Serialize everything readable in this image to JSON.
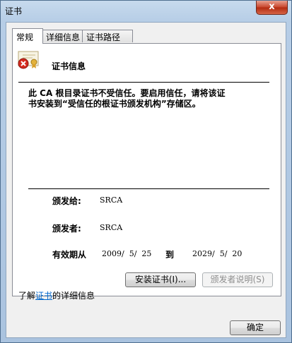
{
  "window": {
    "title": "证书",
    "close_label": "x"
  },
  "tabs": [
    {
      "label": "常规",
      "active": true
    },
    {
      "label": "详细信息",
      "active": false
    },
    {
      "label": "证书路径",
      "active": false
    }
  ],
  "general": {
    "info_title": "证书信息",
    "warning_line1": "此 CA 根目录证书不受信任。要启用信任，请将该证",
    "warning_line2": "书安装到“受信任的根证书颁发机构”存储区。",
    "issued_to_label": "颁发给:",
    "issued_to_value": "SRCA",
    "issued_by_label": "颁发者:",
    "issued_by_value": "SRCA",
    "validity_label": "有效期从",
    "valid_from": "2009/  5/  25",
    "to_label": "到",
    "valid_to": "2029/  5/  20"
  },
  "buttons": {
    "install": "安装证书(I)...",
    "issuer_statement": "颁发者说明(S)",
    "ok": "确定"
  },
  "learn_more": {
    "prefix": "了解",
    "link": "证书",
    "suffix": "的详细信息"
  },
  "colors": {
    "close": "#c7432a",
    "link": "#0066cc"
  }
}
